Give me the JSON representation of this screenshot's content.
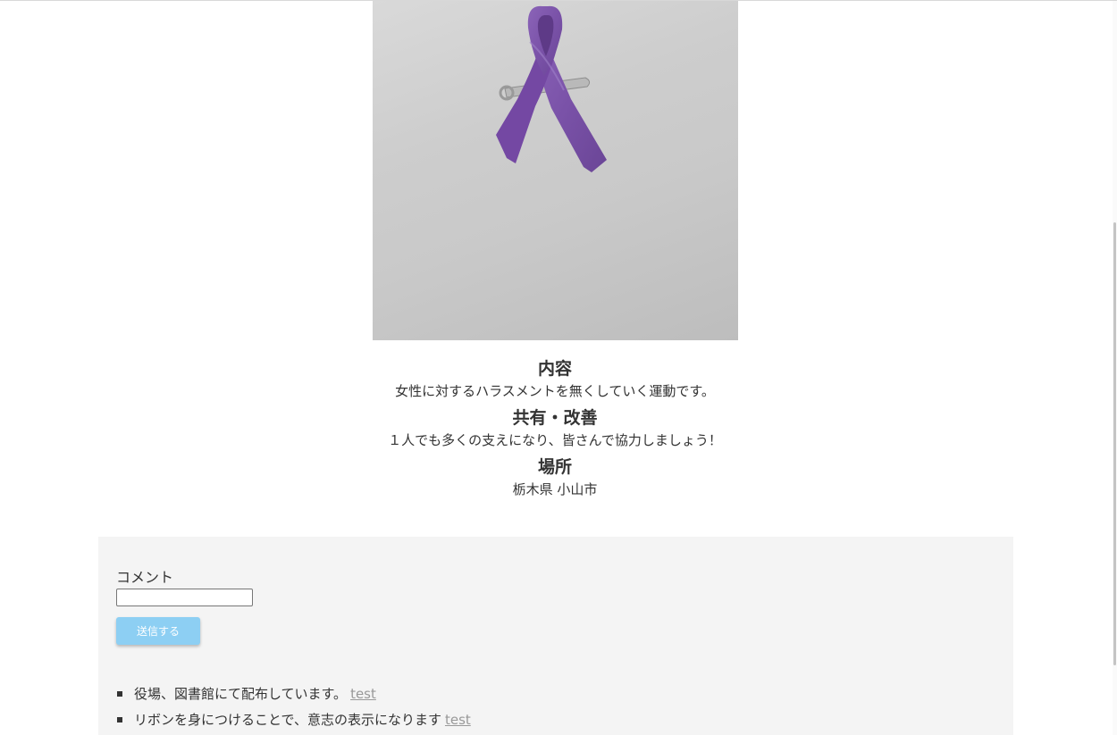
{
  "photo": {
    "subject": "purple ribbon pin",
    "accent_color": "#7d55a8"
  },
  "sections": [
    {
      "heading": "内容",
      "text": "女性に対するハラスメントを無くしていく運動です。"
    },
    {
      "heading": "共有・改善",
      "text": "１人でも多くの支えになり、皆さんで協力しましょう！"
    },
    {
      "heading": "場所",
      "text": "栃木県 小山市"
    }
  ],
  "comment_form": {
    "label": "コメント",
    "input_value": "",
    "submit_label": "送信する",
    "button_color": "#8dcff3"
  },
  "comments": [
    {
      "text": "役場、図書館にて配布しています。",
      "user": "test"
    },
    {
      "text": "リボンを身につけることで、意志の表示になります",
      "user": "test"
    }
  ]
}
